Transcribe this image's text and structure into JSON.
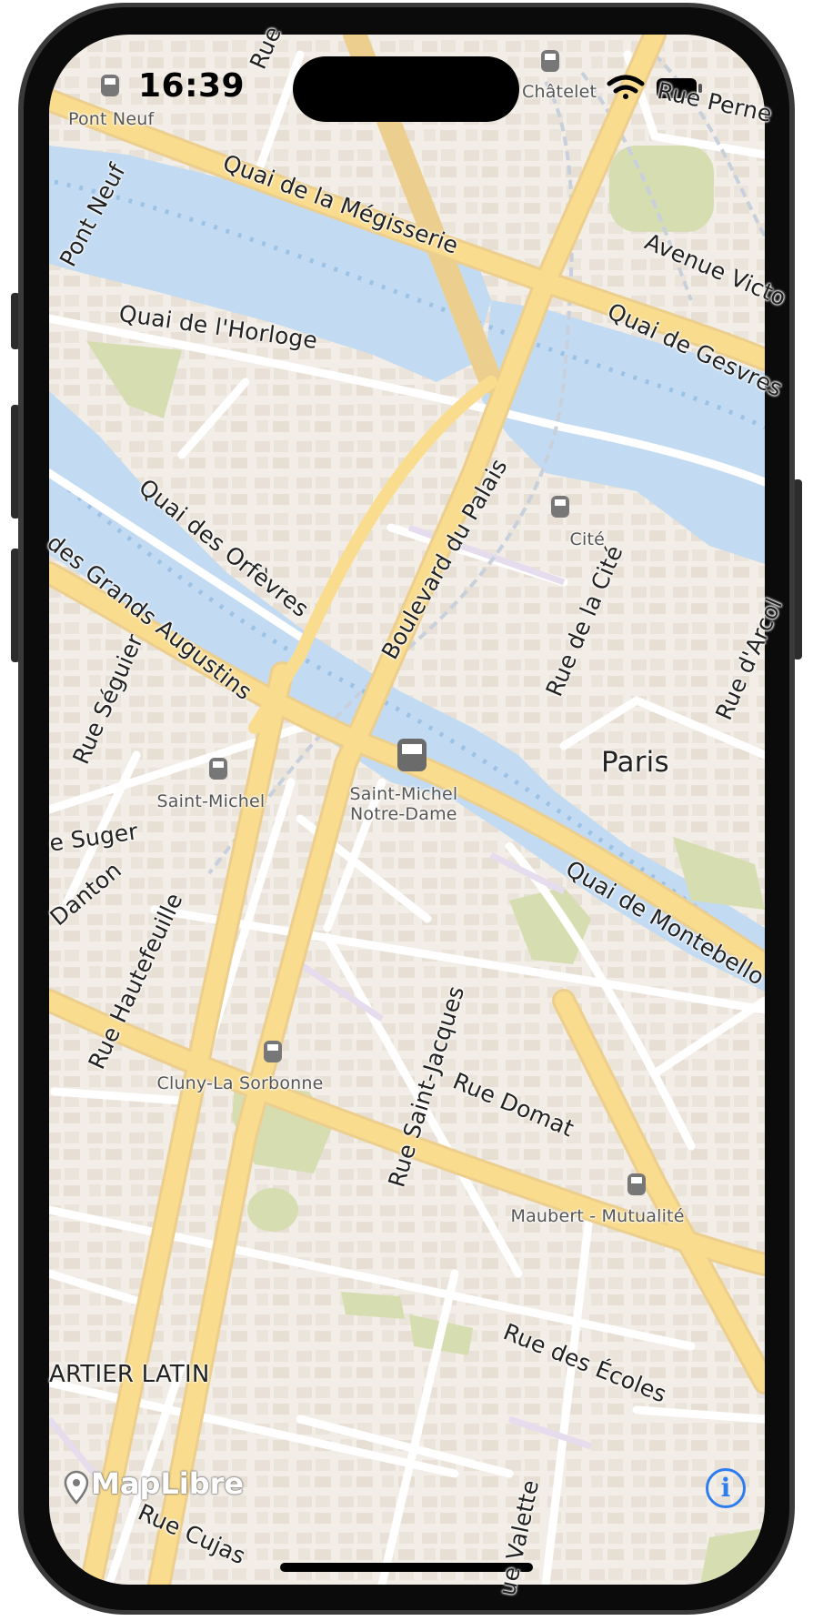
{
  "status_bar": {
    "time": "16:39",
    "wifi_icon": "wifi-icon",
    "battery_icon": "battery-icon"
  },
  "map": {
    "city_label": "Paris",
    "district_label": "ARTIER LATIN",
    "stations": [
      {
        "name": "Pont Neuf"
      },
      {
        "name": "Châtelet"
      },
      {
        "name": "Cité"
      },
      {
        "name": "Saint-Michel"
      },
      {
        "name": "Saint-Michel",
        "line2": "Notre-Dame"
      },
      {
        "name": "Cluny-La Sorbonne"
      },
      {
        "name": "Maubert - Mutualité"
      }
    ],
    "streets": [
      "Rue",
      "Rue Perne",
      "Quai de la Mégisserie",
      "Pont Neuf",
      "Avenue Victo",
      "Quai de l'Horloge",
      "Quai de Gesvres",
      "Quai des Orfèvres",
      "Boulevard du Palais",
      "des Grands Augustins",
      "Rue de la Cité",
      "Rue d'Arcol",
      "Rue Séguier",
      "e Suger",
      "Danton",
      "Quai de Montebello",
      "Rue Hautefeuille",
      "Rue Saint-Jacques",
      "Rue Domat",
      "Rue des Écoles",
      "Rue Cujas",
      "ue Valette"
    ]
  },
  "attribution": {
    "logo_text": "MapLibre",
    "info_button": "i"
  },
  "colors": {
    "land": "#f2ede6",
    "water": "#c3dbf2",
    "park": "#d6deb1",
    "major_road": "#f9dc8d",
    "road_casing": "#eccf8e",
    "minor_road": "#ffffff",
    "rail": "#c8d0dc"
  }
}
